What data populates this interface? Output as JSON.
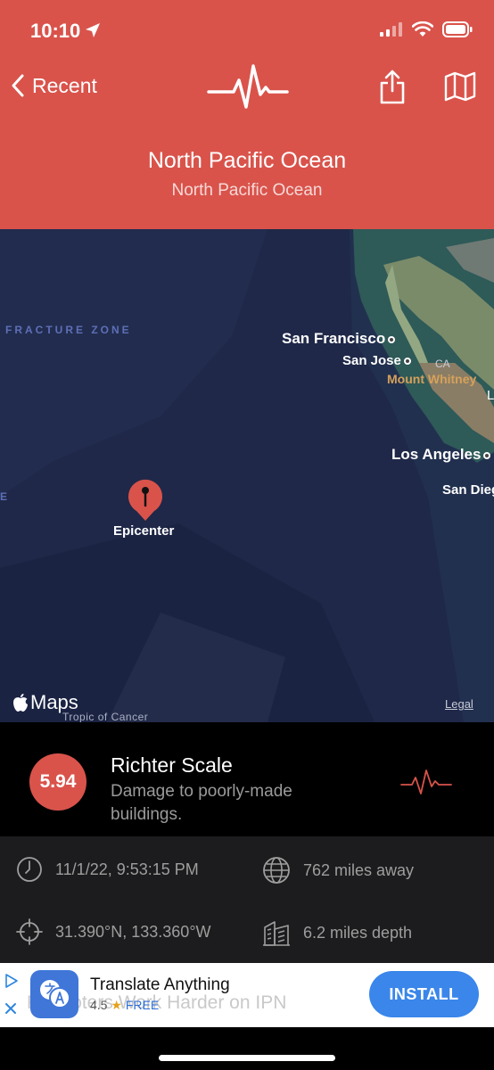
{
  "status_bar": {
    "time": "10:10",
    "icons": [
      "location-arrow-icon",
      "cellular-signal-icon",
      "wifi-icon",
      "battery-icon"
    ]
  },
  "nav": {
    "back_label": "Recent",
    "logo": "seismograph-pulse-icon",
    "share": "share-icon",
    "map": "map-icon"
  },
  "header": {
    "title": "North Pacific Ocean",
    "subtitle": "North Pacific Ocean",
    "color": "#d9534b"
  },
  "map": {
    "labels": {
      "fracture_zone": "FRACTURE ZONE",
      "zone_fragment": "E",
      "san_francisco": "San Francisco",
      "san_jose": "San Jose",
      "state": "CA",
      "mount_whitney": "Mount Whitney",
      "edge_letter": "L",
      "los_angeles": "Los Angeles",
      "san_diego": "San Dieg",
      "epicenter": "Epicenter",
      "tropic": "Tropic of Cancer"
    },
    "attribution": "Maps",
    "legal": "Legal"
  },
  "magnitude": {
    "value": "5.94",
    "scale": "Richter Scale",
    "description": "Damage to poorly-made buildings."
  },
  "details": {
    "time": "11/1/22, 9:53:15 PM",
    "distance": "762 miles away",
    "coordinates": "31.390°N, 133.360°W",
    "depth": "6.2 miles depth"
  },
  "ad": {
    "ghost_text": "Promoters Work Harder on IPN",
    "title": "Translate Anything",
    "rating": "4.5",
    "star": "★",
    "price": "FREE",
    "button": "INSTALL"
  }
}
